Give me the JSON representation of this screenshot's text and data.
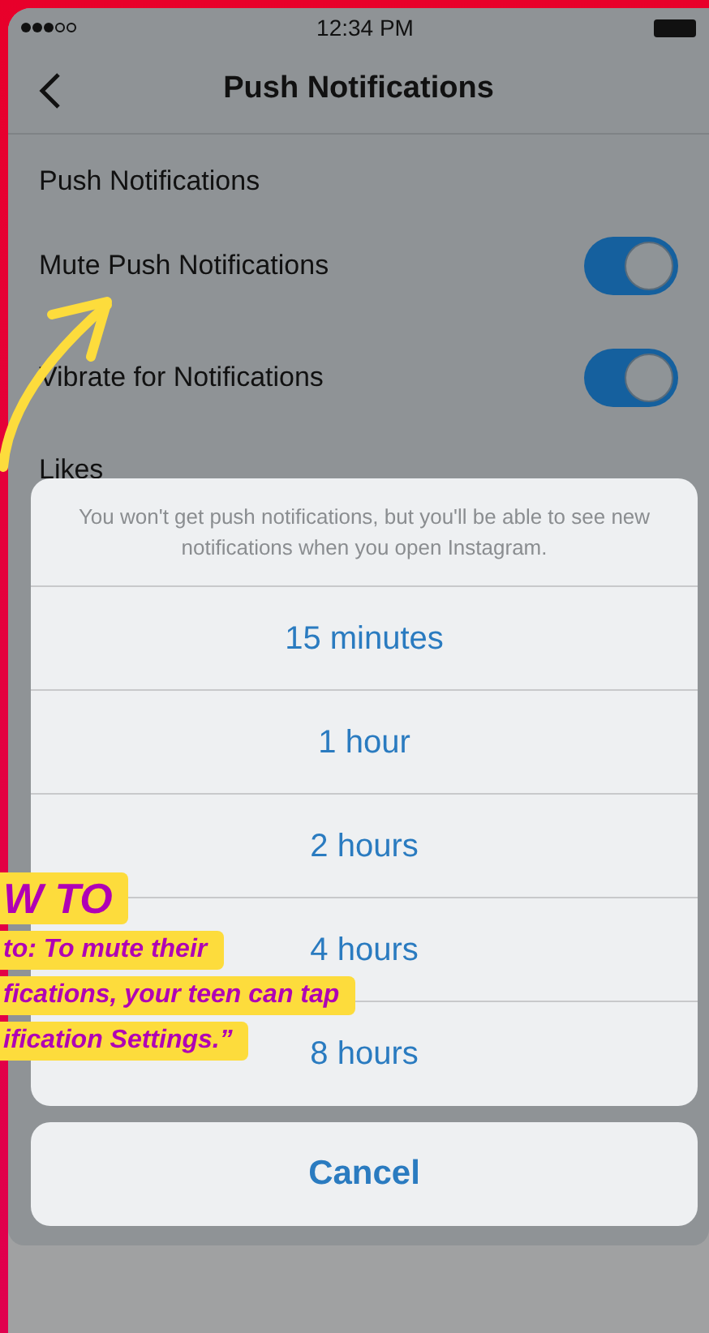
{
  "status_bar": {
    "time": "12:34 PM"
  },
  "nav": {
    "title": "Push Notifications"
  },
  "section_title": "Push Notifications",
  "settings": [
    {
      "label": "Mute Push Notifications",
      "on": true
    },
    {
      "label": "Vibrate for Notifications",
      "on": true
    }
  ],
  "section_2_title": "Likes",
  "sheet": {
    "message": "You won't get push notifications, but you'll be able to see new notifications when you open Instagram.",
    "options": [
      "15 minutes",
      "1 hour",
      "2 hours",
      "4 hours",
      "8 hours"
    ],
    "cancel": "Cancel"
  },
  "annotation": {
    "lines": [
      "W TO",
      "to: To mute their",
      "fications, your teen can tap",
      "ification Settings.”"
    ]
  }
}
